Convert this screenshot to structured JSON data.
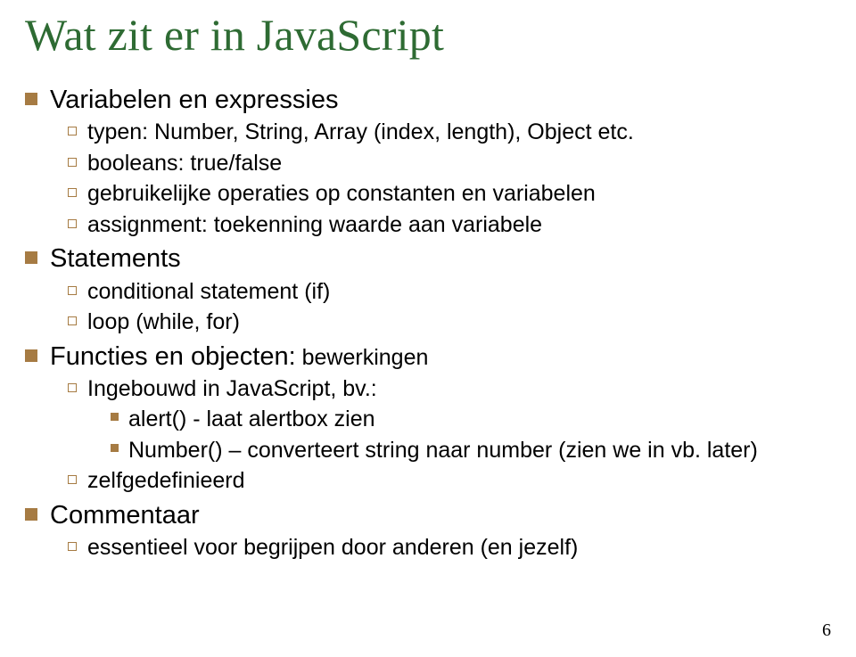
{
  "title": "Wat zit er in JavaScript",
  "items": [
    {
      "head": "Variabelen en expressies",
      "tail": "",
      "sub": [
        {
          "text": "typen: Number, String, Array (index, length), Object etc."
        },
        {
          "text": "booleans: true/false"
        },
        {
          "text": "gebruikelijke operaties op constanten en variabelen"
        },
        {
          "text": "assignment: toekenning waarde aan variabele"
        }
      ]
    },
    {
      "head": "Statements",
      "tail": "",
      "sub": [
        {
          "text": "conditional statement (if)"
        },
        {
          "text": "loop (while, for)"
        }
      ]
    },
    {
      "head": "Functies en objecten:",
      "tail": " bewerkingen",
      "sub": [
        {
          "text": "Ingebouwd in JavaScript, bv.:",
          "sub": [
            {
              "text": "alert()  - laat alertbox zien"
            },
            {
              "text": "Number() – converteert string naar number (zien we in vb. later)"
            }
          ]
        },
        {
          "text": "zelfgedefinieerd"
        }
      ]
    },
    {
      "head": "Commentaar",
      "tail": "",
      "sub": [
        {
          "text": "essentieel voor begrijpen door anderen (en jezelf)"
        }
      ]
    }
  ],
  "pageNumber": "6"
}
